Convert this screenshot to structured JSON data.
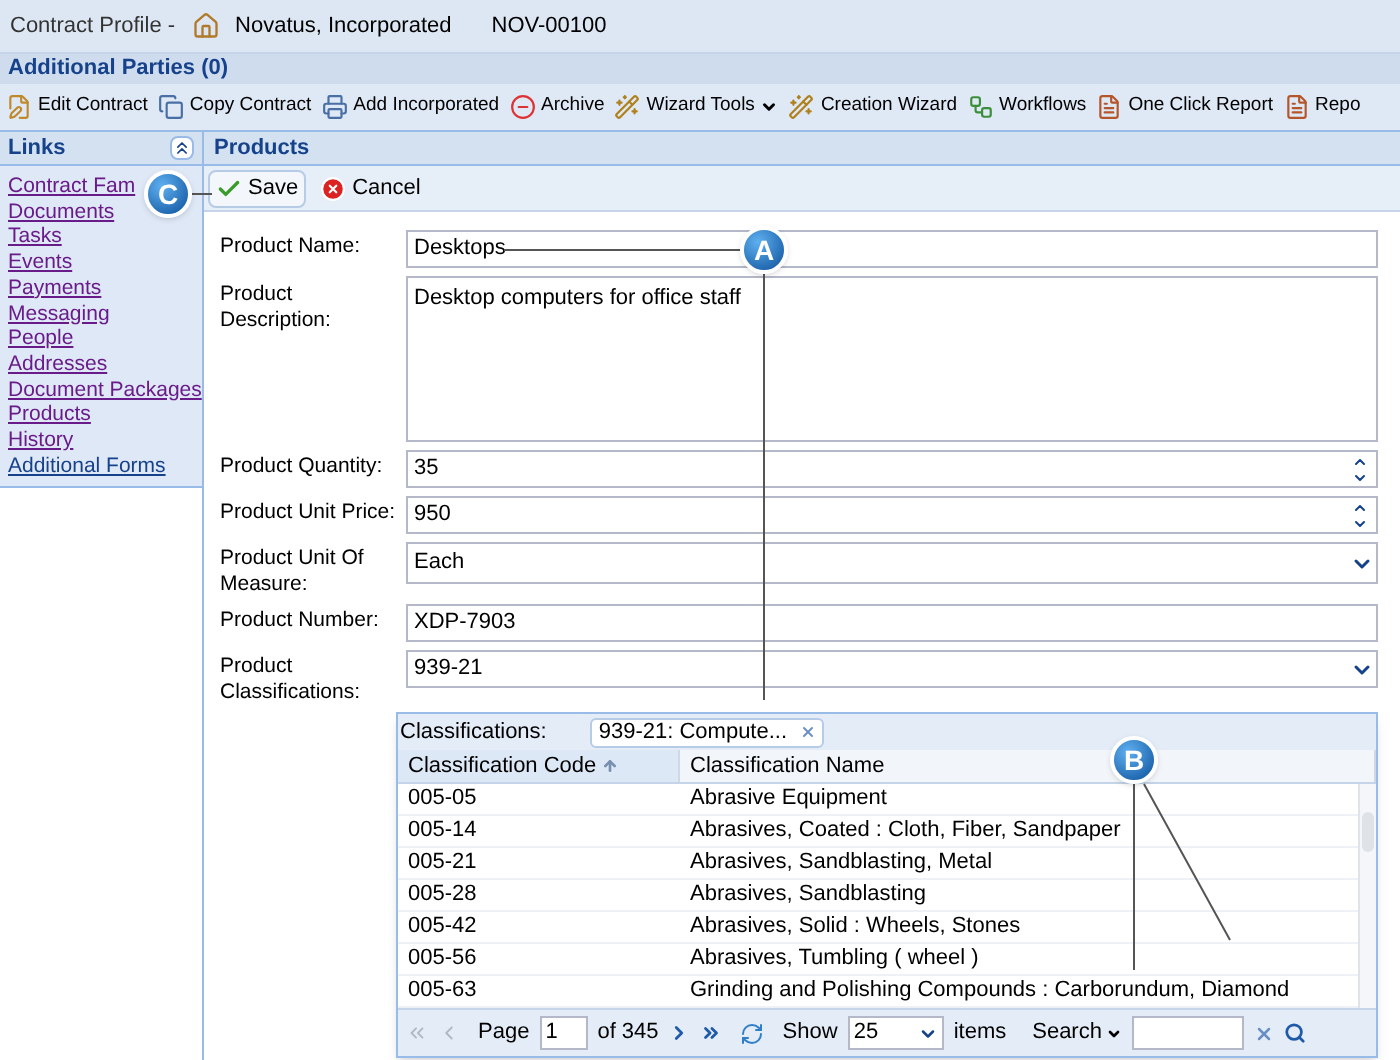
{
  "title_bar": {
    "prefix": "Contract Profile -",
    "company": "Novatus, Incorporated",
    "contract_id": "NOV-00100"
  },
  "additional_parties": "Additional Parties (0)",
  "toolbar": [
    {
      "kind": "edit",
      "label": "Edit Contract"
    },
    {
      "kind": "copy",
      "label": "Copy Contract"
    },
    {
      "kind": "add",
      "label": "Add Incorporated"
    },
    {
      "kind": "archive",
      "label": "Archive"
    },
    {
      "kind": "wizard",
      "label": "Wizard Tools",
      "menu": true
    },
    {
      "kind": "wizard",
      "label": "Creation Wizard"
    },
    {
      "kind": "workflow",
      "label": "Workflows"
    },
    {
      "kind": "report",
      "label": "One Click Report"
    },
    {
      "kind": "report",
      "label": "Repo"
    }
  ],
  "links_panel": {
    "title": "Links",
    "items": [
      {
        "label": "Contract Fam",
        "visited": true
      },
      {
        "label": "Documents",
        "visited": true
      },
      {
        "label": "Tasks",
        "visited": true
      },
      {
        "label": "Events",
        "visited": true
      },
      {
        "label": "Payments",
        "visited": true
      },
      {
        "label": "Messaging",
        "visited": true
      },
      {
        "label": "People",
        "visited": true
      },
      {
        "label": "Addresses",
        "visited": true
      },
      {
        "label": "Document Packages",
        "visited": true
      },
      {
        "label": "Products",
        "visited": true
      },
      {
        "label": "History",
        "visited": true
      },
      {
        "label": "Additional Forms",
        "visited": false
      }
    ]
  },
  "products_panel": {
    "title": "Products",
    "actions": [
      {
        "kind": "save",
        "label": "Save"
      },
      {
        "kind": "cancel",
        "label": "Cancel"
      }
    ],
    "fields": [
      {
        "kind": "text",
        "label": "Product Name:",
        "value": "Desktops"
      },
      {
        "kind": "textarea",
        "label": "Product Description:",
        "value": "Desktop computers for office staff"
      },
      {
        "kind": "number",
        "label": "Product Quantity:",
        "value": "35"
      },
      {
        "kind": "number",
        "label": "Product Unit Price:",
        "value": "950"
      },
      {
        "kind": "select",
        "label": "Product Unit Of Measure:",
        "value": "Each"
      },
      {
        "kind": "text",
        "label": "Product Number:",
        "value": "XDP-7903"
      },
      {
        "kind": "select",
        "label": "Product Classifications:",
        "value": "939-21"
      }
    ],
    "classification_popup": {
      "label": "Classifications:",
      "chips": [
        "939-21: Compute..."
      ],
      "columns": [
        {
          "label": "Classification Code",
          "sorted": true
        },
        {
          "label": "Classification Name",
          "sorted": false
        }
      ],
      "rows": [
        [
          "005-05",
          "Abrasive Equipment"
        ],
        [
          "005-14",
          "Abrasives, Coated : Cloth, Fiber, Sandpaper"
        ],
        [
          "005-21",
          "Abrasives, Sandblasting, Metal"
        ],
        [
          "005-28",
          "Abrasives, Sandblasting"
        ],
        [
          "005-42",
          "Abrasives, Solid : Wheels, Stones"
        ],
        [
          "005-56",
          "Abrasives, Tumbling ( wheel )"
        ],
        [
          "005-63",
          "Grinding and Polishing Compounds : Carborundum, Diamond"
        ]
      ],
      "pager": {
        "page_label": "Page",
        "page": "1",
        "of": "of 345",
        "show_label": "Show",
        "page_size": "25",
        "items_label": "items",
        "search_label": "Search",
        "first_disabled": true,
        "last_disabled": false
      }
    }
  },
  "callouts": [
    "A",
    "B",
    "C"
  ]
}
